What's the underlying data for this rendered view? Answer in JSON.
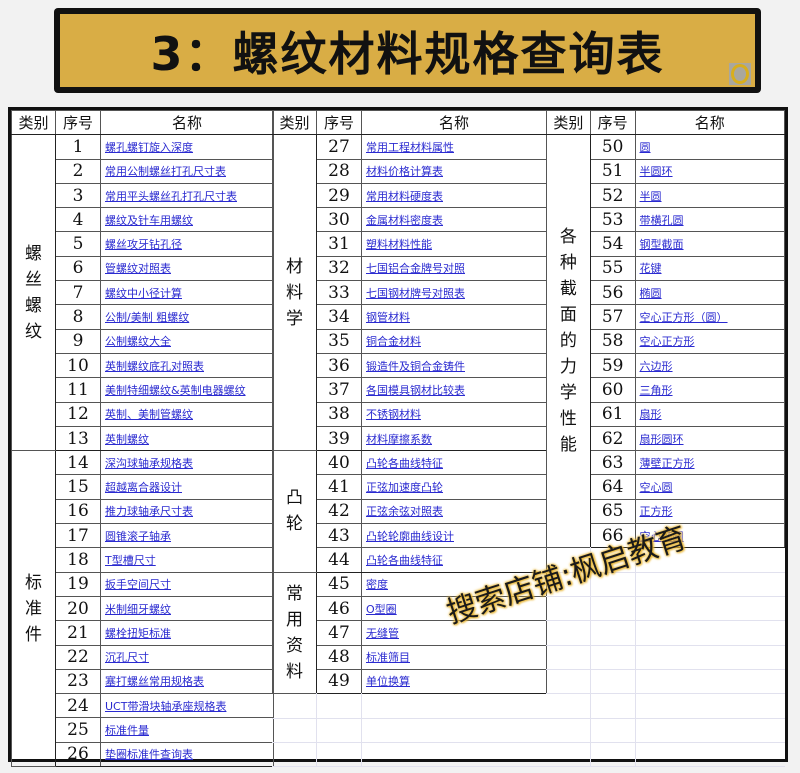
{
  "header": {
    "title": "3：螺纹材料规格查询表",
    "badge_icon": "ring-icon"
  },
  "columns": {
    "category": "类别",
    "index": "序号",
    "name": "名称"
  },
  "tables": [
    {
      "groups": [
        {
          "category": "螺丝螺纹",
          "rows": [
            {
              "no": "1",
              "name": "螺孔螺钉旋入深度"
            },
            {
              "no": "2",
              "name": "常用公制螺丝打孔尺寸表"
            },
            {
              "no": "3",
              "name": "常用平头螺丝孔打孔尺寸表"
            },
            {
              "no": "4",
              "name": "螺纹及针车用螺纹"
            },
            {
              "no": "5",
              "name": "螺丝攻牙钻孔径"
            },
            {
              "no": "6",
              "name": "管螺纹对照表"
            },
            {
              "no": "7",
              "name": "螺纹中小径计算"
            },
            {
              "no": "8",
              "name": "公制/美制 粗螺纹"
            },
            {
              "no": "9",
              "name": "公制螺纹大全"
            },
            {
              "no": "10",
              "name": "英制螺纹底孔对照表"
            },
            {
              "no": "11",
              "name": "美制特细螺纹&英制电器螺纹"
            },
            {
              "no": "12",
              "name": "英制、美制管螺纹"
            },
            {
              "no": "13",
              "name": "英制螺纹"
            }
          ]
        },
        {
          "category": "标准件",
          "rows": [
            {
              "no": "14",
              "name": "深沟球轴承规格表"
            },
            {
              "no": "15",
              "name": "超越离合器设计"
            },
            {
              "no": "16",
              "name": "推力球轴承尺寸表"
            },
            {
              "no": "17",
              "name": "圆锥滚子轴承"
            },
            {
              "no": "18",
              "name": "T型槽尺寸"
            },
            {
              "no": "19",
              "name": "扳手空间尺寸"
            },
            {
              "no": "20",
              "name": "米制细牙螺纹"
            },
            {
              "no": "21",
              "name": "螺栓扭矩标准"
            },
            {
              "no": "22",
              "name": "沉孔尺寸"
            },
            {
              "no": "23",
              "name": "塞打螺丝常用规格表"
            },
            {
              "no": "24",
              "name": "UCT带滑块轴承座规格表"
            },
            {
              "no": "25",
              "name": "标准件量"
            },
            {
              "no": "26",
              "name": "垫圈标准件查询表"
            }
          ]
        }
      ]
    },
    {
      "groups": [
        {
          "category": "材料学",
          "rows": [
            {
              "no": "27",
              "name": "常用工程材料属性"
            },
            {
              "no": "28",
              "name": "材料价格计算表"
            },
            {
              "no": "29",
              "name": "常用材料硬度表"
            },
            {
              "no": "30",
              "name": "金属材料密度表"
            },
            {
              "no": "31",
              "name": "塑料材料性能"
            },
            {
              "no": "32",
              "name": "七国铝合金牌号对照"
            },
            {
              "no": "33",
              "name": "七国钢材牌号对照表"
            },
            {
              "no": "34",
              "name": "钢管材料"
            },
            {
              "no": "35",
              "name": "铜合金材料"
            },
            {
              "no": "36",
              "name": "锻造件及铜合金铸件"
            },
            {
              "no": "37",
              "name": "各国模具钢材比较表"
            },
            {
              "no": "38",
              "name": "不锈钢材料"
            },
            {
              "no": "39",
              "name": "材料摩擦系数"
            }
          ]
        },
        {
          "category": "凸轮",
          "rows": [
            {
              "no": "40",
              "name": "凸轮各曲线特征"
            },
            {
              "no": "41",
              "name": "正弦加速度凸轮"
            },
            {
              "no": "42",
              "name": "正弦余弦对照表"
            },
            {
              "no": "43",
              "name": "凸轮轮廓曲线设计"
            },
            {
              "no": "44",
              "name": "凸轮各曲线特征"
            }
          ]
        },
        {
          "category": "常用资料",
          "rows": [
            {
              "no": "45",
              "name": "密度"
            },
            {
              "no": "46",
              "name": "O型圈"
            },
            {
              "no": "47",
              "name": "无缝管"
            },
            {
              "no": "48",
              "name": "标准筛目"
            },
            {
              "no": "49",
              "name": "单位换算"
            }
          ]
        }
      ]
    },
    {
      "groups": [
        {
          "category": "各种截面的力学性能",
          "rows": [
            {
              "no": "50",
              "name": "圆"
            },
            {
              "no": "51",
              "name": "半圆环"
            },
            {
              "no": "52",
              "name": "半圆"
            },
            {
              "no": "53",
              "name": "带横孔圆"
            },
            {
              "no": "54",
              "name": "钢型截面"
            },
            {
              "no": "55",
              "name": "花键"
            },
            {
              "no": "56",
              "name": "椭圆"
            },
            {
              "no": "57",
              "name": "空心正方形（圆）"
            },
            {
              "no": "58",
              "name": "空心正方形"
            },
            {
              "no": "59",
              "name": "六边形"
            },
            {
              "no": "60",
              "name": "三角形"
            },
            {
              "no": "61",
              "name": "扇形"
            },
            {
              "no": "62",
              "name": "扇形圆环"
            },
            {
              "no": "63",
              "name": "薄壁正方形"
            },
            {
              "no": "64",
              "name": "空心圆"
            },
            {
              "no": "65",
              "name": "正方形"
            },
            {
              "no": "66",
              "name": "空心椭圆"
            }
          ]
        }
      ]
    }
  ],
  "watermark": "搜索店铺:枫启教育",
  "colors": {
    "banner": "#d9ad45",
    "link": "#2a2ad0",
    "border": "#111111"
  }
}
